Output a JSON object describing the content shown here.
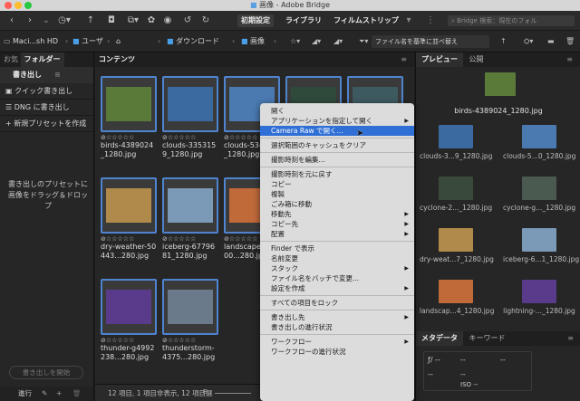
{
  "window": {
    "title": "画像 - Adobe Bridge"
  },
  "toolbar": {
    "workspaces": [
      "初期設定",
      "ライブラリ",
      "フィルムストリップ"
    ],
    "search_placeholder": "Bridge 検索：現在のフォル"
  },
  "pathbar": {
    "crumbs": [
      "Maci...sh HD",
      "ユーザ",
      "ダウンロード",
      "画像"
    ],
    "sort_label": "ファイル名を基準に並べ替え"
  },
  "left_panel": {
    "tabs": [
      "お気",
      "フォルダー"
    ],
    "export_tab": "書き出し",
    "items": [
      "クイック書き出し",
      "DNG に書き出し",
      "新規プリセットを作成"
    ],
    "help_text": "書き出しのプリセットに画像をドラッグ＆ドロップ",
    "start_button": "書き出しを開始",
    "progress_label": "進行"
  },
  "content": {
    "tab": "コンテンツ",
    "thumbnails": [
      {
        "name": "birds-4389024_1280.jpg",
        "color": "#5a7a3a"
      },
      {
        "name": "clouds-3353159_1280.jpg",
        "color": "#3a6aa0"
      },
      {
        "name": "clouds-534...40_1280.jpg",
        "color": "#4a7ab0"
      },
      {
        "name": "",
        "color": "#2f4a3a"
      },
      {
        "name": "",
        "color": "#3d5a60"
      },
      {
        "name": "dry-weather-50443...280.jpg",
        "color": "#b08a4a"
      },
      {
        "name": "iceberg-6779681_1280.jpg",
        "color": "#7a9ab8"
      },
      {
        "name": "landscape-...4200...280.jpg",
        "color": "#c06a3a"
      },
      {
        "name": "thunder-g4992238...280.jpg",
        "color": "#5a3a8a"
      },
      {
        "name": "thunderstorm-4375...280.jpg",
        "color": "#6a7a8a"
      }
    ],
    "stars": "☆☆☆☆☆",
    "status": "12 項目, 1 項目非表示, 12 項目選"
  },
  "context_menu": {
    "items": [
      {
        "label": "開く",
        "sub": false
      },
      {
        "label": "アプリケーションを指定して開く",
        "sub": true
      },
      {
        "label": "Camera Raw で開く...",
        "sub": false,
        "highlight": true
      },
      {
        "sep": true
      },
      {
        "label": "選択範囲のキャッシュをクリア",
        "sub": false
      },
      {
        "sep": true
      },
      {
        "label": "撮影時刻を編集...",
        "sub": false
      },
      {
        "sep": true
      },
      {
        "label": "撮影時刻を元に戻す",
        "sub": false
      },
      {
        "label": "コピー",
        "sub": false
      },
      {
        "label": "複製",
        "sub": false
      },
      {
        "label": "ごみ箱に移動",
        "sub": false
      },
      {
        "label": "移動先",
        "sub": true
      },
      {
        "label": "コピー先",
        "sub": true
      },
      {
        "label": "配置",
        "sub": true
      },
      {
        "sep": true
      },
      {
        "label": "Finder で表示",
        "sub": false
      },
      {
        "label": "名前変更",
        "sub": false
      },
      {
        "label": "スタック",
        "sub": true
      },
      {
        "label": "ファイル名をバッチで変更...",
        "sub": false
      },
      {
        "label": "設定を作成",
        "sub": true
      },
      {
        "sep": true
      },
      {
        "label": "すべての項目をロック",
        "sub": false
      },
      {
        "sep": true
      },
      {
        "label": "書き出し先",
        "sub": true
      },
      {
        "label": "書き出しの進行状況",
        "sub": false
      },
      {
        "sep": true
      },
      {
        "label": "ワークフロー",
        "sub": true
      },
      {
        "label": "ワークフローの進行状況",
        "sub": false
      }
    ]
  },
  "right_panel": {
    "tabs": [
      "プレビュー",
      "公開"
    ],
    "preview_name": "birds-4389024_1280.jpg",
    "thumbs": [
      {
        "name": "clouds-3...9_1280.jpg",
        "color": "#3a6aa0"
      },
      {
        "name": "clouds-5...0_1280.jpg",
        "color": "#4a7ab0"
      },
      {
        "name": "cyclone-2..._1280.jpg",
        "color": "#3a4a3a"
      },
      {
        "name": "cyclone-g..._1280.jpg",
        "color": "#4a5a50"
      },
      {
        "name": "dry-weat...7_1280.jpg",
        "color": "#b08a4a"
      },
      {
        "name": "iceberg-6...1_1280.jpg",
        "color": "#7a9ab8"
      },
      {
        "name": "landscap...4_1280.jpg",
        "color": "#c06a3a"
      },
      {
        "name": "lightning-..._1280.jpg",
        "color": "#5a3a8a"
      }
    ],
    "meta_tabs": [
      "メタデータ",
      "キーワード"
    ],
    "meta_values": [
      "ƒ/ --",
      "--",
      "--",
      "--",
      "ISO --",
      "--"
    ]
  },
  "colors": {
    "accent": "#4f84d1",
    "menu_highlight": "#2f6fd6"
  }
}
